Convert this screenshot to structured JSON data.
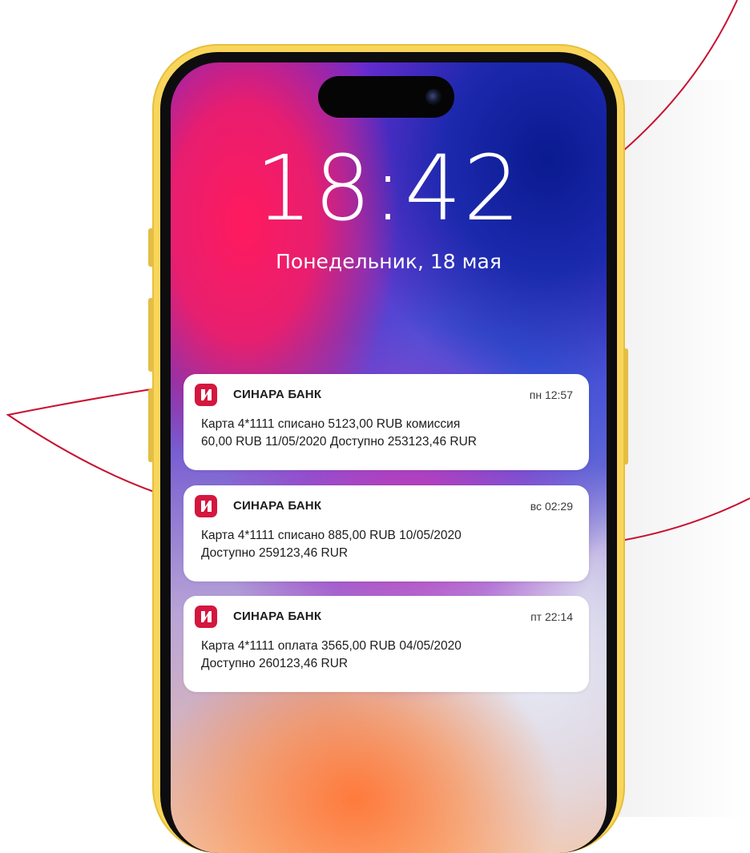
{
  "lock_screen": {
    "time": "18:42",
    "date": "Понедельник, 18 мая"
  },
  "notifications": [
    {
      "app": "СИНАРА БАНК",
      "time": "пн 12:57",
      "line1": "Карта 4*1111 списано 5123,00 RUB комиссия",
      "line2": "60,00 RUB 11/05/2020 Доступно 253123,46 RUR"
    },
    {
      "app": "СИНАРА БАНК",
      "time": "вс 02:29",
      "line1": "Карта 4*1111 списано 885,00 RUB 10/05/2020",
      "line2": "Доступно 259123,46 RUR"
    },
    {
      "app": "СИНАРА БАНК",
      "time": "пт 22:14",
      "line1": "Карта 4*1111 оплата 3565,00 RUB 04/05/2020",
      "line2": "Доступно 260123,46 RUR"
    }
  ],
  "colors": {
    "phone_frame": "#f9d65b",
    "bank_brand": "#d4173e",
    "decor_line": "#c8102e"
  },
  "icons": {
    "app_icon": "sinara-bank-logo-icon",
    "camera": "front-camera-icon"
  }
}
